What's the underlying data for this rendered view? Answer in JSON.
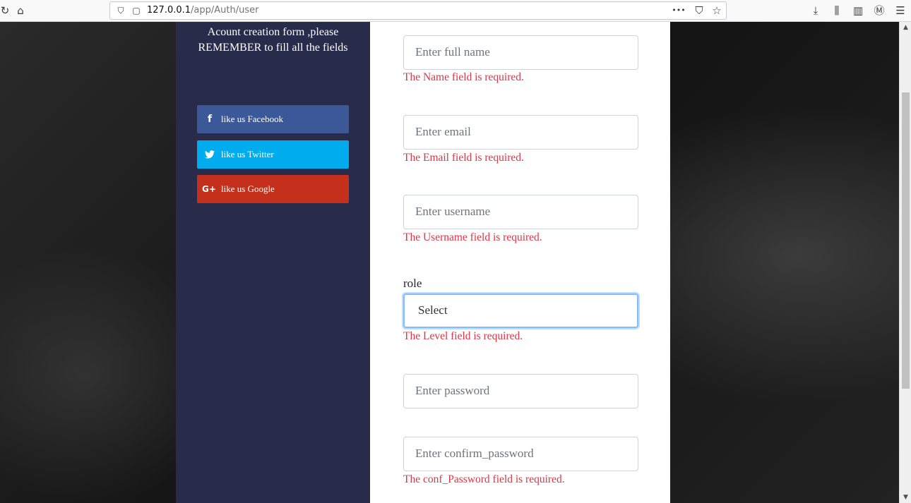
{
  "browser": {
    "url_host": "127.0.0.1",
    "url_path": "/app/Auth/user",
    "icons": {
      "back": "↻",
      "home": "⌂",
      "page": "▢",
      "more": "•••",
      "pocket": "⛉",
      "bookmark": "☆",
      "download": "⤓",
      "library": "⫼",
      "sidebar": "▥",
      "account": "Ⓜ",
      "menu": "☰"
    }
  },
  "sidebar": {
    "title": "Acount creation form ,please REMEMBER to fill all the fields",
    "social": [
      {
        "icon": "f",
        "label": "like us Facebook",
        "color": "#3b5998"
      },
      {
        "icon": "🐦",
        "label": "like us Twitter",
        "color": "#00acee"
      },
      {
        "icon": "G+",
        "label": "like us Google",
        "color": "#c4301b"
      }
    ]
  },
  "form": {
    "fullname": {
      "placeholder": "Enter full name",
      "error": "The Name field is required."
    },
    "email": {
      "placeholder": "Enter email",
      "error": "The Email field is required."
    },
    "username": {
      "placeholder": "Enter username",
      "error": "The Username field is required."
    },
    "role": {
      "label": "role",
      "selected": "Select",
      "error": "The Level field is required."
    },
    "password": {
      "placeholder": "Enter password"
    },
    "confirm_password": {
      "placeholder": "Enter confirm_password",
      "error": "The conf_Password field is required."
    }
  }
}
